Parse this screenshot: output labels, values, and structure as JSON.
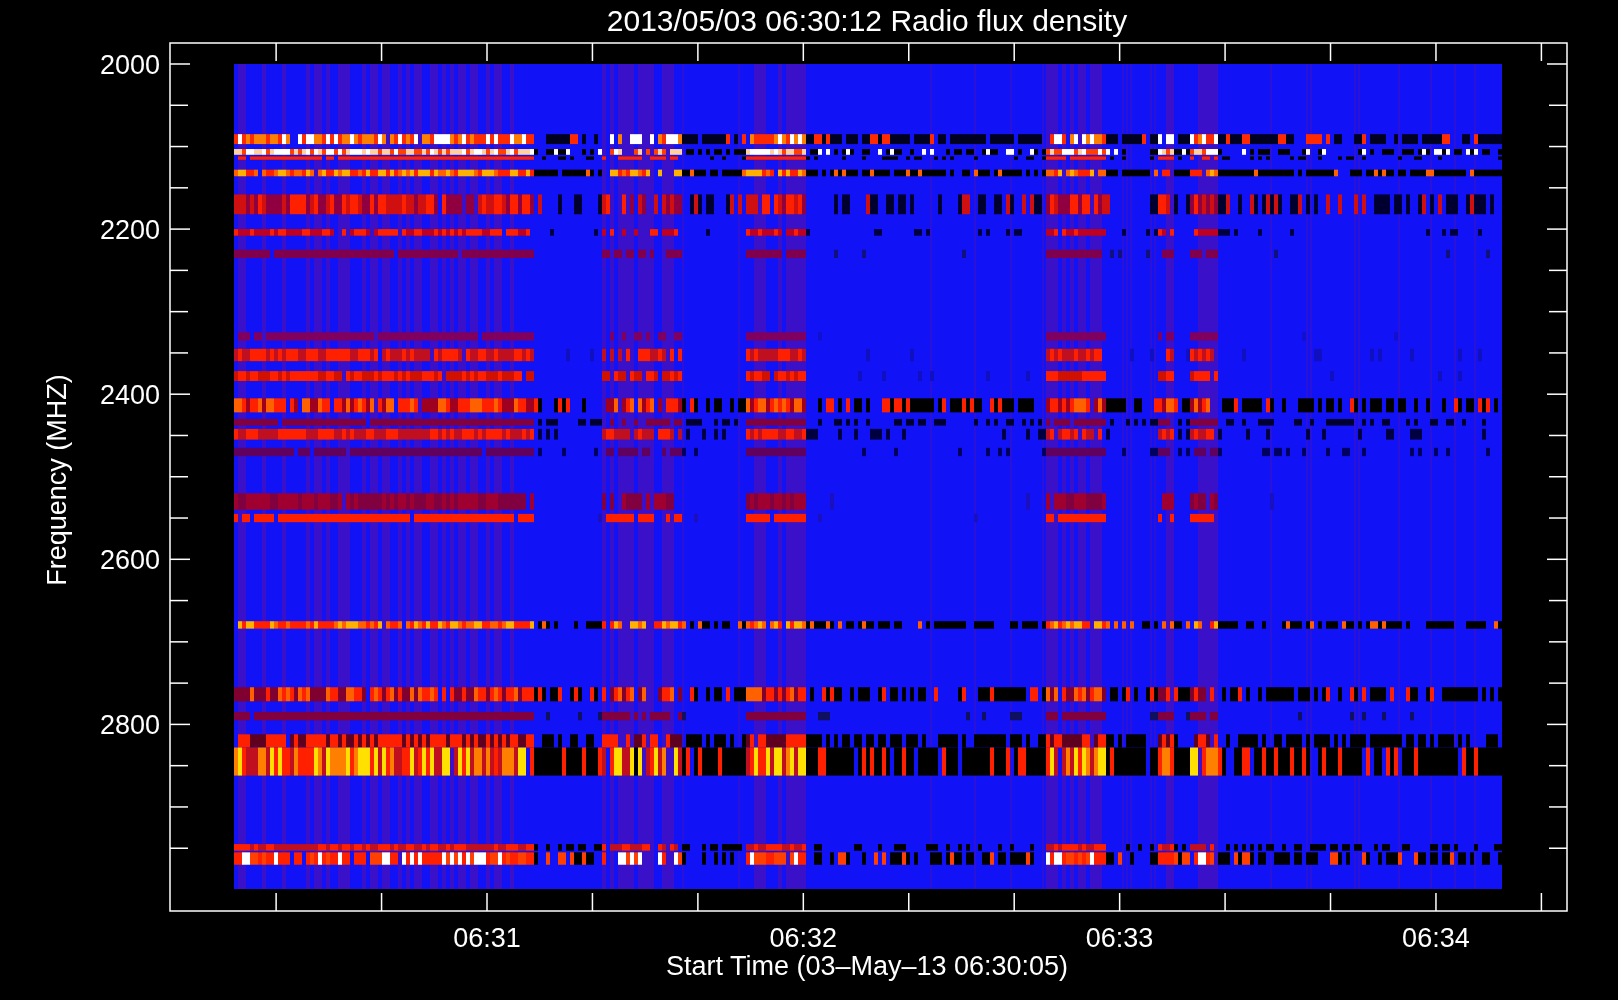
{
  "title": "2013/05/03 06:30:12 Radio flux density",
  "y_axis": {
    "label": "Frequency (MHZ)",
    "ticks": [
      "2000",
      "2200",
      "2400",
      "2600",
      "2800"
    ]
  },
  "x_axis": {
    "label": "Start Time (03‒May‒13 06:30:05)",
    "ticks": [
      "06:31",
      "06:32",
      "06:33",
      "06:34"
    ]
  }
}
